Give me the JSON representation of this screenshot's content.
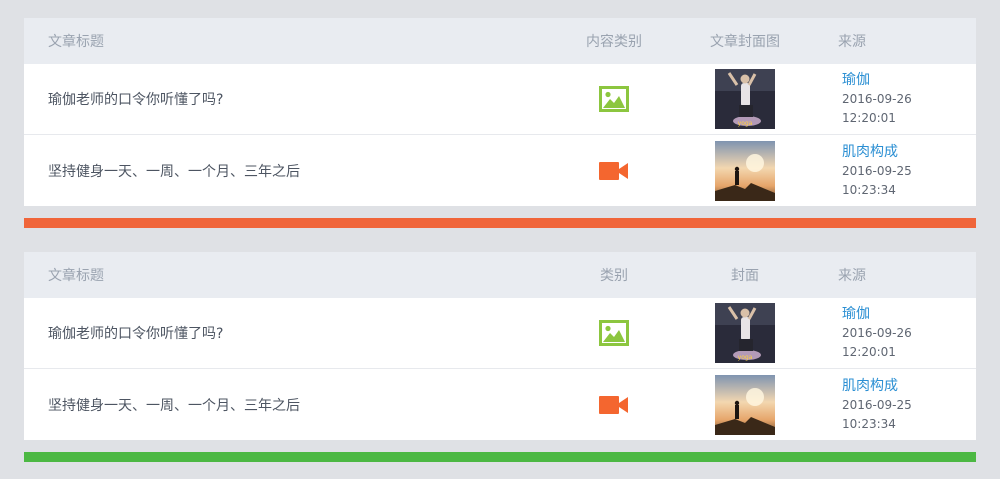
{
  "panels": [
    {
      "headers": {
        "title": "文章标题",
        "type": "内容类别",
        "cover": "文章封面图",
        "source": "来源"
      },
      "rows": [
        {
          "title": "瑜伽老师的口令你听懂了吗?",
          "type_icon": "image-icon",
          "cover": "yoga-thumbnail",
          "source": "瑜伽",
          "date": "2016-09-26",
          "time": "12:20:01"
        },
        {
          "title": "坚持健身一天、一周、一个月、三年之后",
          "type_icon": "video-icon",
          "cover": "sunset-silhouette-thumbnail",
          "source": "肌肉构成",
          "date": "2016-09-25",
          "time": "10:23:34"
        }
      ],
      "accent_color": "#f0653a"
    },
    {
      "headers": {
        "title": "文章标题",
        "type": "类别",
        "cover": "封面",
        "source": "来源"
      },
      "rows": [
        {
          "title": "瑜伽老师的口令你听懂了吗?",
          "type_icon": "image-icon",
          "cover": "yoga-thumbnail",
          "source": "瑜伽",
          "date": "2016-09-26",
          "time": "12:20:01"
        },
        {
          "title": "坚持健身一天、一周、一个月、三年之后",
          "type_icon": "video-icon",
          "cover": "sunset-silhouette-thumbnail",
          "source": "肌肉构成",
          "date": "2016-09-25",
          "time": "10:23:34"
        }
      ],
      "accent_color": "#4cb843"
    }
  ],
  "colors": {
    "image_icon": "#8cc63f",
    "video_icon": "#f4662f",
    "link": "#2b8fd3"
  }
}
